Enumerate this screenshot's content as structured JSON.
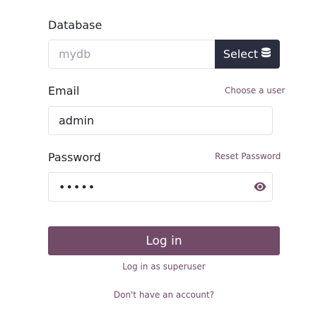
{
  "database": {
    "label": "Database",
    "placeholder": "mydb",
    "select_label": "Select",
    "select_icon": "database-icon"
  },
  "email": {
    "label": "Email",
    "value": "admin",
    "choose_user_link": "Choose a user"
  },
  "password": {
    "label": "Password",
    "value": "•••••",
    "reset_link": "Reset Password",
    "reveal_icon": "eye-icon"
  },
  "actions": {
    "login_label": "Log in",
    "superuser_link": "Log in as superuser",
    "signup_link": "Don't have an account?"
  },
  "colors": {
    "primary": "#714B67",
    "select_button": "#2a2e3f",
    "border": "#dee2e6"
  }
}
